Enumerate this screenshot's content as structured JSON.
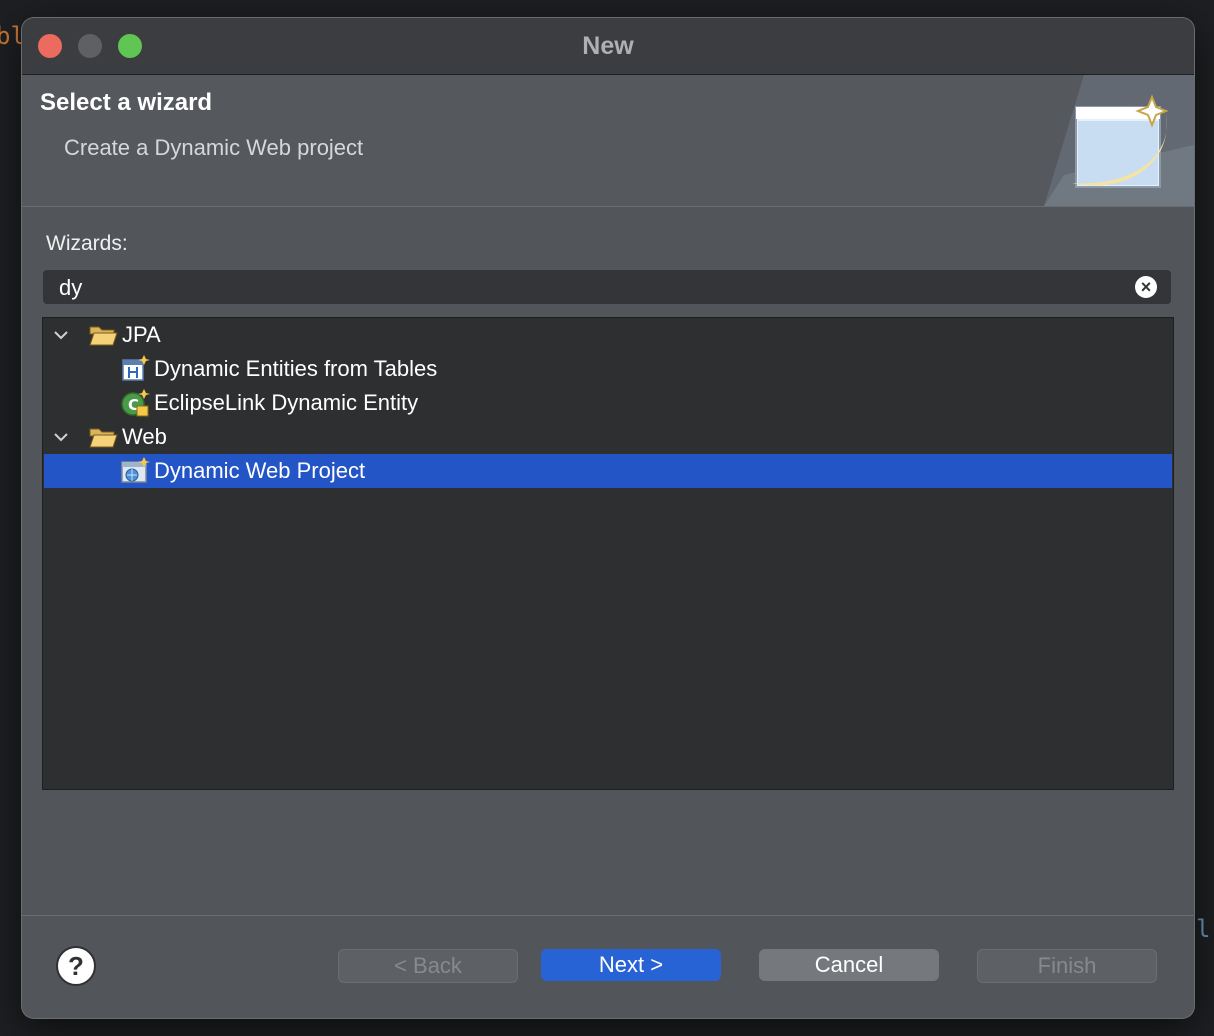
{
  "background_code": {
    "left": "bl",
    "right": "l"
  },
  "window": {
    "title": "New"
  },
  "header": {
    "title": "Select a wizard",
    "description": "Create a Dynamic Web project"
  },
  "wizards": {
    "label": "Wizards:",
    "filter_value": "dy",
    "clear_icon": "clear-icon",
    "tree": [
      {
        "label": "JPA",
        "type": "category",
        "expanded": true
      },
      {
        "label": "Dynamic Entities from Tables",
        "type": "wizard",
        "icon": "entities-wizard-icon"
      },
      {
        "label": "EclipseLink Dynamic Entity",
        "type": "wizard",
        "icon": "eclipselink-wizard-icon"
      },
      {
        "label": "Web",
        "type": "category",
        "expanded": true
      },
      {
        "label": "Dynamic Web Project",
        "type": "wizard",
        "icon": "web-project-wizard-icon",
        "selected": true
      }
    ]
  },
  "buttons": {
    "help": "?",
    "back": "< Back",
    "next": "Next >",
    "cancel": "Cancel",
    "finish": "Finish"
  },
  "colors": {
    "selection": "#2455c7",
    "primary_button": "#2863d6",
    "folder": "#f5d27a"
  }
}
